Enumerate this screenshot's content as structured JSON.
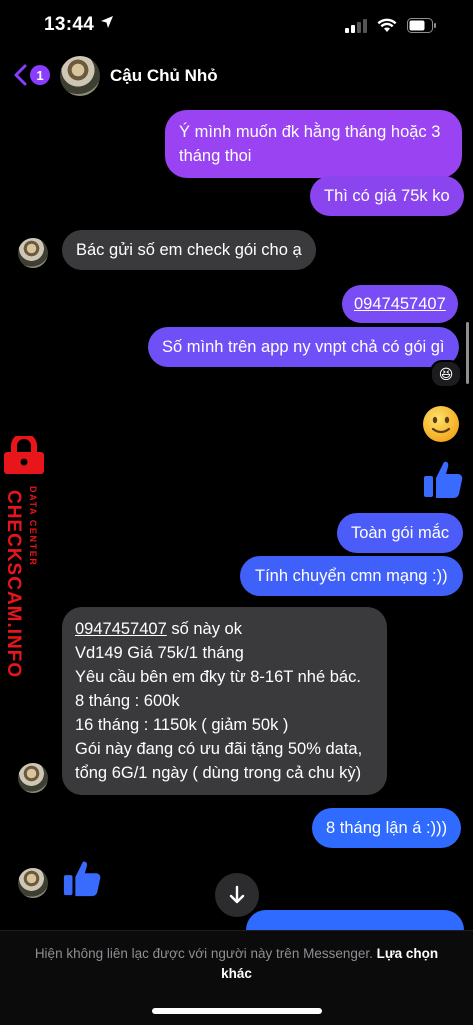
{
  "status": {
    "time": "13:44"
  },
  "header": {
    "back_badge": "1",
    "title": "Cậu Chủ Nhỏ"
  },
  "messages": [
    {
      "dir": "out",
      "text": "Ý mình muốn đk hằng tháng hoặc 3 tháng thoi"
    },
    {
      "dir": "out",
      "text": "Thì có giá 75k ko"
    },
    {
      "dir": "in",
      "text": "Bác gửi số em check gói cho ạ"
    },
    {
      "dir": "out",
      "text": "0947457407",
      "link": true
    },
    {
      "dir": "out",
      "text": "Số mình trên app ny vnpt chả có gói gì",
      "reaction": "😆"
    },
    {
      "dir": "out",
      "emoji": "🙂"
    },
    {
      "dir": "out",
      "emoji": "like"
    },
    {
      "dir": "out",
      "text": "Toàn gói mắc"
    },
    {
      "dir": "out",
      "text": "Tính chuyển cmn mạng :))"
    },
    {
      "dir": "in",
      "lines": [
        {
          "link": "0947457407",
          "text": " số này ok"
        },
        "Vd149 Giá 75k/1 tháng",
        "Yêu cầu bên em đky từ 8-16T nhé bác.",
        "8 tháng : 600k",
        "16 tháng : 1150k ( giảm 50k )",
        "Gói này đang có ưu đãi tặng 50% data,",
        "tổng 6G/1 ngày ( dùng trong cả chu kỳ)"
      ]
    },
    {
      "dir": "out",
      "text": "8 tháng lận á :)))"
    },
    {
      "dir": "in",
      "emoji": "like"
    }
  ],
  "footer": {
    "notice": "Hiện không liên lạc được với người này trên Messenger.",
    "action": "Lựa chọn khác"
  },
  "watermark": {
    "big": "CHECKSCAM.INFO",
    "small": "DATA CENTER"
  },
  "colors": {
    "accent": "#8a3dff",
    "gradient_top": "#a040f0",
    "gradient_bottom": "#2f6bff",
    "incoming": "#3a3a3c"
  },
  "icons": [
    "location-arrow-icon",
    "signal-icon",
    "wifi-icon",
    "battery-icon",
    "chevron-left-icon",
    "arrow-down-icon",
    "thumbs-up-icon"
  ]
}
